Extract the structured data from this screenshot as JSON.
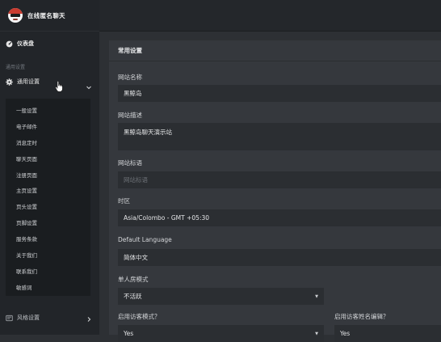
{
  "brand": {
    "name": "在线匿名聊天"
  },
  "sidebar": {
    "dashboard_label": "仪表盘",
    "section_label": "通用设置",
    "settings_group_label": "通用设置",
    "submenu": [
      {
        "label": "一般设置"
      },
      {
        "label": "电子邮件"
      },
      {
        "label": "消息定时"
      },
      {
        "label": "聊天页面"
      },
      {
        "label": "注册页面"
      },
      {
        "label": "主页设置"
      },
      {
        "label": "页头设置"
      },
      {
        "label": "页脚设置"
      },
      {
        "label": "服务条款"
      },
      {
        "label": "关于我们"
      },
      {
        "label": "联系我们"
      },
      {
        "label": "敏感词"
      }
    ],
    "bottom_label": "风格设置"
  },
  "card": {
    "title": "常用设置",
    "site_name": {
      "label": "网站名称",
      "value": "黑鲸岛"
    },
    "site_description": {
      "label": "网站描述",
      "value": "黑鲸岛聊天演示站"
    },
    "site_slogan": {
      "label": "网站标语",
      "placeholder": "网站标语"
    },
    "timezone": {
      "label": "时区",
      "value": "Asia/Colombo - GMT +05:30"
    },
    "default_language": {
      "label": "Default Language",
      "value": "简体中文"
    },
    "single_room_mode": {
      "label": "单人房模式",
      "value": "不活跃"
    },
    "guest_mode": {
      "label": "启用访客模式？",
      "value": "Yes"
    },
    "guest_name_edit": {
      "label": "启用访客姓名编辑？",
      "value": "Yes"
    }
  },
  "colors": {
    "sidebar_bg": "#222529",
    "main_bg": "#2d3034",
    "card_bg": "#35383d",
    "field_bg": "#2b2e32"
  },
  "icons": {
    "dashboard": "dashboard-gauge-icon",
    "settings": "gear-icon",
    "chevron": "chevron-icon",
    "style": "style-settings-icon",
    "cursor": "hand-pointer-icon"
  }
}
